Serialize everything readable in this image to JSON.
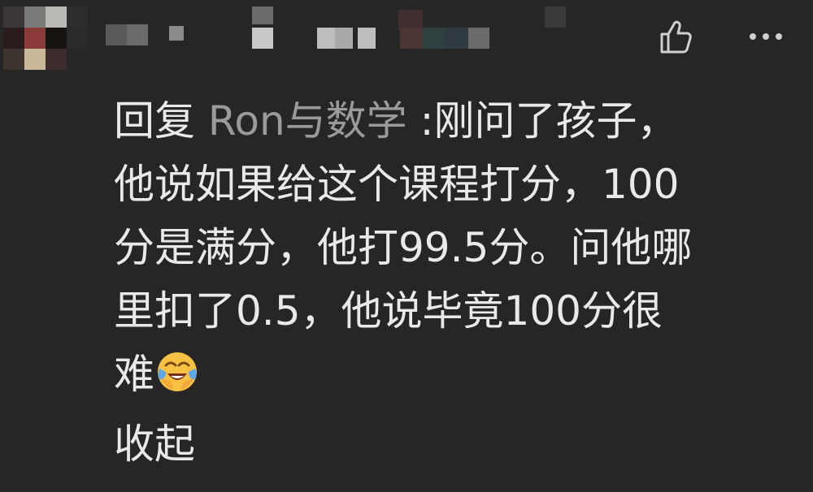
{
  "comment": {
    "reply_prefix": "回复",
    "reply_to": "Ron与数学",
    "text_lines": [
      ":刚问了孩子，",
      "他说如果给这个课程打分，100",
      "分是满分，他打99.5分。问他哪",
      "里扣了0.5，他说毕竟100分很",
      "难"
    ],
    "emoji": "face-with-tears-of-joy-icon",
    "collapse_label": "收起"
  },
  "actions": {
    "like_icon": "thumbs-up-icon",
    "more_icon": "more-dots-icon"
  },
  "colors": {
    "background": "#262626",
    "text": "#e9e9e9",
    "reply_name": "#9a9a9a"
  }
}
